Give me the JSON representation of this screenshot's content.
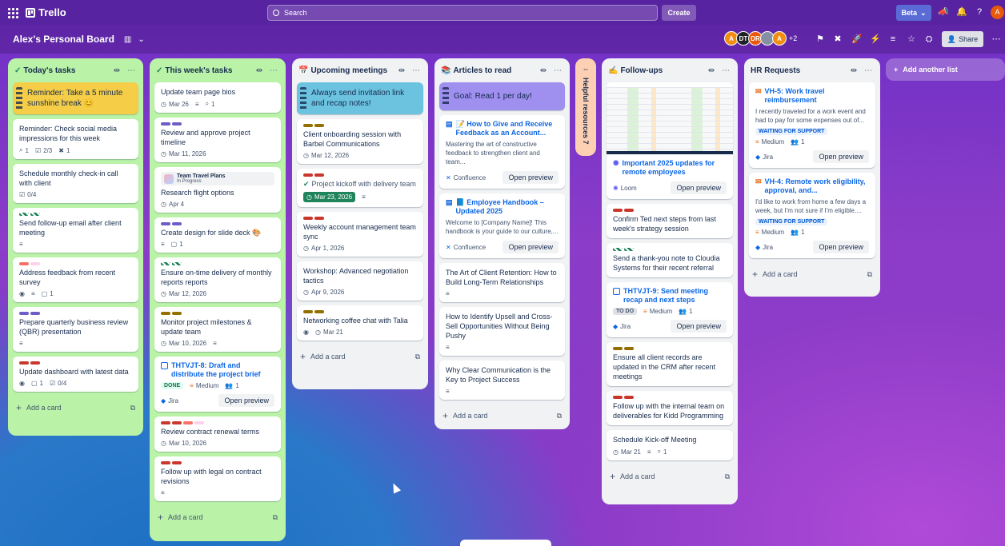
{
  "topbar": {
    "app_name": "Trello",
    "search_placeholder": "Search",
    "create_label": "Create",
    "beta_label": "Beta",
    "user_initial": "A"
  },
  "board": {
    "title": "Alex's Personal Board",
    "members": [
      {
        "initials": "A",
        "color": "#f18d13"
      },
      {
        "initials": "DT",
        "color": "#1d2125"
      },
      {
        "initials": "DR",
        "color": "#e8590c"
      },
      {
        "initials": "",
        "color": "#8590a2"
      },
      {
        "initials": "A",
        "color": "#f18d13"
      }
    ],
    "members_more": "+2",
    "share_label": "Share"
  },
  "lists": [
    {
      "title": "Today's tasks",
      "add_label": "Add a card",
      "cards": [
        {
          "title": "Reminder: Take a 5 minute sunshine break 😊"
        },
        {
          "title": "Reminder: Check social media impressions for this week",
          "attach": "1",
          "check": "2/3",
          "jira": "1"
        },
        {
          "title": "Schedule monthly check-in call with client",
          "check": "0/4"
        },
        {
          "title": "Send follow-up email after client meeting"
        },
        {
          "title": "Address feedback from recent survey",
          "comments": "1"
        },
        {
          "title": "Prepare quarterly business review (QBR) presentation"
        },
        {
          "title": "Update dashboard with latest data",
          "comments": "1",
          "check": "0/4"
        }
      ]
    },
    {
      "title": "This week's tasks",
      "add_label": "Add a card",
      "cards": [
        {
          "title": "Update team page bios",
          "date": "Mar 26",
          "attach": "1"
        },
        {
          "title": "Review and approve project timeline",
          "date": "Mar 11, 2026"
        },
        {
          "title": "Research flight options",
          "link_title": "Team Travel Plans",
          "link_status": "In Progress",
          "date": "Apr 4"
        },
        {
          "title": "Create design for slide deck 🎨",
          "comments": "1"
        },
        {
          "title": "Ensure on-time delivery of monthly reports reports",
          "date": "Mar 12, 2026"
        },
        {
          "title": "Monitor project milestones & update team",
          "date": "Mar 10, 2026"
        },
        {
          "title": "THTVJT-8: Draft and distribute the project brief",
          "status": "DONE",
          "priority": "Medium",
          "assignees": "1",
          "source": "Jira",
          "action": "Open preview"
        },
        {
          "title": "Review contract renewal terms",
          "date": "Mar 10, 2026"
        },
        {
          "title": "Follow up with legal on contract revisions"
        }
      ]
    },
    {
      "title": "Upcoming meetings",
      "add_label": "Add a card",
      "cards": [
        {
          "title": "Always send invitation link and recap notes!"
        },
        {
          "title": "Client onboarding session with Barbel Communications",
          "date": "Mar 12, 2026"
        },
        {
          "title": "Project kickoff with delivery team",
          "date": "Mar 23, 2026"
        },
        {
          "title": "Weekly account management team sync",
          "date": "Apr 1, 2026"
        },
        {
          "title": "Workshop: Advanced negotiation tactics",
          "date": "Apr 9, 2026"
        },
        {
          "title": "Networking coffee chat with Talia",
          "date": "Mar 21"
        }
      ]
    },
    {
      "title": "Articles to read",
      "add_label": "Add a card",
      "cards": [
        {
          "title": "Goal: Read 1 per day!"
        },
        {
          "title": "📝 How to Give and Receive Feedback as an Account...",
          "desc": "Mastering the art of constructive feedback to strengthen client and team...",
          "source": "Confluence",
          "action": "Open preview"
        },
        {
          "title": "📘 Employee Handbook – Updated 2025",
          "desc": "Welcome to [Company Name]! This handbook is your guide to our culture,...",
          "source": "Confluence",
          "action": "Open preview"
        },
        {
          "title": "The Art of Client Retention: How to Build Long-Term Relationships"
        },
        {
          "title": "How to Identify Upsell and Cross-Sell Opportunities Without Being Pushy"
        },
        {
          "title": "Why Clear Communication is the Key to Project Success"
        }
      ]
    },
    {
      "title": "Helpful resources",
      "count": "7"
    },
    {
      "title": "Follow-ups",
      "add_label": "Add a card",
      "cards": [
        {
          "title": "Important 2025 updates for remote employees",
          "source": "Loom",
          "action": "Open preview"
        },
        {
          "title": "Confirm Ted next steps from last week's strategy session"
        },
        {
          "title": "Send a thank-you note to Cloudia Systems for their recent referral"
        },
        {
          "title": "THTVJT-9: Send meeting recap and next steps",
          "status": "TO DO",
          "priority": "Medium",
          "assignees": "1",
          "source": "Jira",
          "action": "Open preview"
        },
        {
          "title": "Ensure all client records are updated in the CRM after recent meetings"
        },
        {
          "title": "Follow up with the internal team on deliverables for Kidd Programming"
        },
        {
          "title": "Schedule Kick-off Meeting",
          "date": "Mar 21",
          "attach": "1"
        }
      ]
    },
    {
      "title": "HR Requests",
      "add_label": "Add a card",
      "cards": [
        {
          "title": "VH-5: Work travel reimbursement",
          "desc": "I recently traveled for a work event and had to pay for some expenses out of...",
          "status": "WAITING FOR SUPPORT",
          "priority": "Medium",
          "assignees": "1",
          "source": "Jira",
          "action": "Open preview"
        },
        {
          "title": "VH-4: Remote work eligibility, approval, and...",
          "desc": "I'd like to work from home a few days a week, but I'm not sure if I'm eligible....",
          "status": "WAITING FOR SUPPORT",
          "priority": "Medium",
          "assignees": "1",
          "source": "Jira",
          "action": "Open preview"
        }
      ]
    }
  ],
  "add_list_label": "Add another list",
  "colors": {
    "list_green": "#baf3a8",
    "list_default": "#f1f2f4",
    "yellow_card": "#f5cd47",
    "teal_card": "#6cc3e0",
    "purple_card": "#9f8fef",
    "collapsed_orange": "#fdd0b3",
    "date_green": "#1f845a",
    "jira_blue": "#0c66e4"
  }
}
